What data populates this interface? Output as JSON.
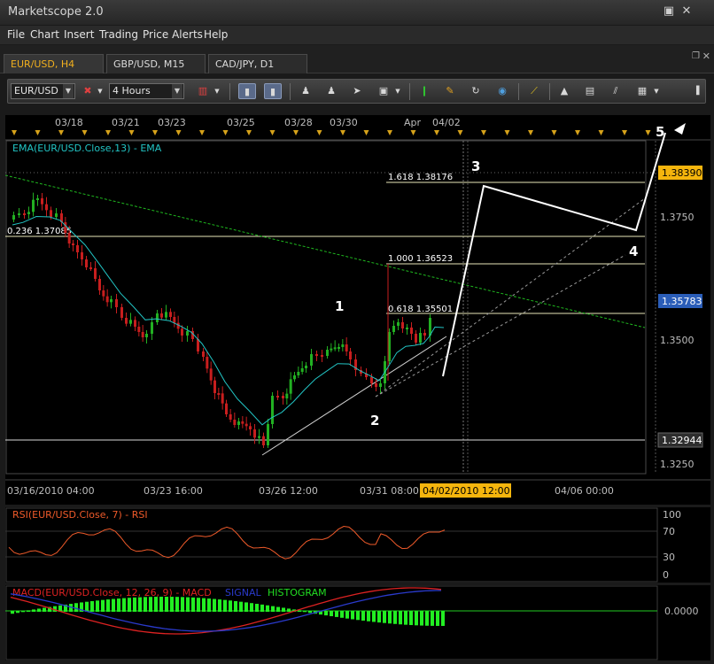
{
  "app": {
    "title": "Marketscope 2.0",
    "window_buttons": [
      "▣",
      "✕"
    ]
  },
  "menu": [
    "File",
    "Chart",
    "Insert",
    "Trading",
    "Price Alerts",
    "Help"
  ],
  "tabs": [
    {
      "label": "EUR/USD, H4",
      "active": true
    },
    {
      "label": "GBP/USD, M15",
      "active": false
    },
    {
      "label": "CAD/JPY, D1",
      "active": false
    }
  ],
  "toolbar": {
    "instrument": "EUR/USD",
    "timeframe": "4 Hours"
  },
  "chart": {
    "top_dates": [
      "03/18",
      "03/21",
      "03/23",
      "03/25",
      "03/28",
      "03/30",
      "Apr",
      "04/02"
    ],
    "indicator_label": "EMA(EUR/USD.Close,13) - EMA",
    "fib_labels": [
      "1.618 1.38176",
      "0.236 1.37085",
      "1.000 1.36523",
      "0.618 1.35501"
    ],
    "wave_labels": [
      "1",
      "2",
      "3",
      "4",
      "5"
    ],
    "price_ticks": [
      "1.3750",
      "1.3500",
      "1.3250"
    ],
    "price_flags": {
      "top": "1.38390",
      "current": "1.35783",
      "low": "1.32944"
    },
    "bottom_dates": [
      "03/16/2010 04:00",
      "03/23 16:00",
      "03/26 12:00",
      "03/31 08:00",
      "04/06 00:00"
    ],
    "cursor_date": "04/02/2010 12:00",
    "colors": {
      "bull": "#22b022",
      "bear": "#c81e1e",
      "ema": "#22c4c4",
      "flag_top": "#f5b50d",
      "flag_current": "#2a5db8"
    }
  },
  "rsi": {
    "label": "RSI(EUR/USD.Close, 7) - RSI",
    "ticks": [
      "100",
      "70",
      "30",
      "0"
    ]
  },
  "macd": {
    "label": "MACD(EUR/USD.Close, 12, 26, 9) - MACD",
    "signal": "SIGNAL",
    "histogram": "HISTOGRAM",
    "tick": "0.0000"
  }
}
